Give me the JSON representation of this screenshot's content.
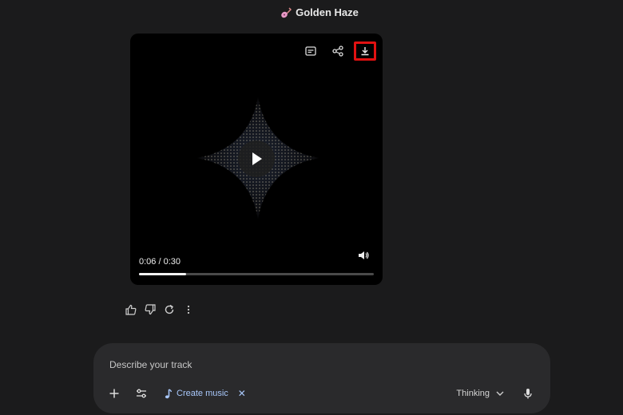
{
  "header": {
    "title": "Golden Haze",
    "icon": "guitar-icon"
  },
  "player": {
    "time_display": "0:06 / 0:30",
    "progress_fraction": 0.2,
    "icons": [
      "captions-icon",
      "share-icon",
      "download-icon",
      "play-icon",
      "volume-icon"
    ],
    "highlight_color": "#e11111"
  },
  "response_actions": [
    "thumbs-up-icon",
    "thumbs-down-icon",
    "regenerate-icon",
    "more-icon"
  ],
  "composer": {
    "placeholder": "Describe your track",
    "tool_chip_label": "Create music",
    "tool_chip_remove": "✕",
    "mode_label": "Thinking",
    "accent_color": "#a8c7fa"
  }
}
